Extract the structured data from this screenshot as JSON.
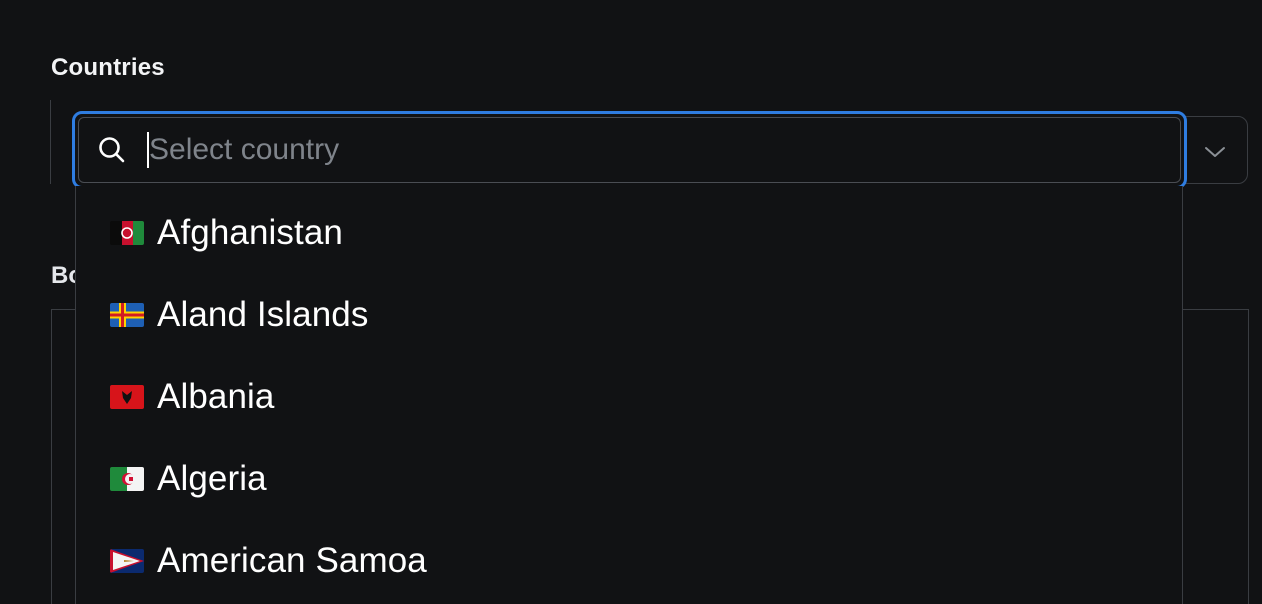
{
  "form": {
    "countries_label": "Countries",
    "second_label_partial": "Bo"
  },
  "search": {
    "placeholder": "Select country",
    "value": ""
  },
  "options": [
    {
      "name": "Afghanistan",
      "flag": "afghanistan-flag-icon"
    },
    {
      "name": "Aland Islands",
      "flag": "aland-islands-flag-icon"
    },
    {
      "name": "Albania",
      "flag": "albania-flag-icon"
    },
    {
      "name": "Algeria",
      "flag": "algeria-flag-icon"
    },
    {
      "name": "American Samoa",
      "flag": "american-samoa-flag-icon"
    }
  ],
  "colors": {
    "background": "#111214",
    "focus_ring": "#2f7de1",
    "border": "#3a3d42",
    "placeholder": "#7f848b"
  }
}
